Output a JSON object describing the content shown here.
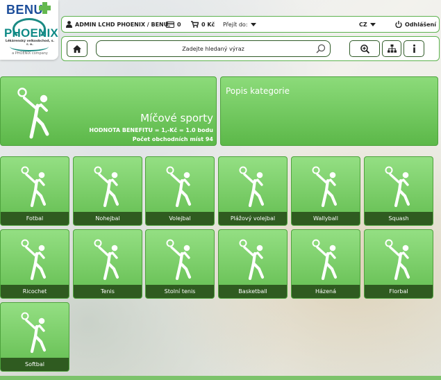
{
  "logo": {
    "benu": "BENU",
    "phoenix": "PHOENIX",
    "subtitle": "Lékárenský velkoobchod, s. r. o.",
    "tagline": "a PHOENIX company"
  },
  "topbar": {
    "user": "ADMIN LCHD PHOENIX / BENU",
    "card_count": "0",
    "cart_total": "0 Kč",
    "goto_label": "Přejít do:",
    "language": "CZ",
    "logout": "Odhlášení"
  },
  "toolbar": {
    "search_placeholder": "Zadejte hledaný výraz"
  },
  "hero": {
    "title": "Míčové sporty",
    "benefit": "HODNOTA BENEFITU = 1,-Kč = 1.0 bodu",
    "places": "Počet obchodních míst 94"
  },
  "description": {
    "title": "Popis kategorie"
  },
  "categories": [
    {
      "label": "Fotbal"
    },
    {
      "label": "Nohejbal"
    },
    {
      "label": "Volejbal"
    },
    {
      "label": "Plážový volejbal"
    },
    {
      "label": "Wallyball"
    },
    {
      "label": "Squash"
    },
    {
      "label": "Ricochet"
    },
    {
      "label": "Tenis"
    },
    {
      "label": "Stolní tenis"
    },
    {
      "label": "Basketball"
    },
    {
      "label": "Házená"
    },
    {
      "label": "Florbal"
    },
    {
      "label": "Softbal"
    }
  ],
  "icons": {
    "user": "user-icon",
    "card": "card-icon",
    "cart": "cart-icon",
    "logout": "power-icon",
    "home": "home-icon",
    "zoom": "zoom-in-icon",
    "tree": "sitemap-icon",
    "info": "info-icon",
    "search": "search-icon",
    "category": "ball-player-icon"
  },
  "colors": {
    "accent_green": "#5db24e",
    "tile_label_bg": "#2f5b20",
    "brand_blue": "#1c4d9a",
    "brand_teal": "#0f8a86"
  }
}
